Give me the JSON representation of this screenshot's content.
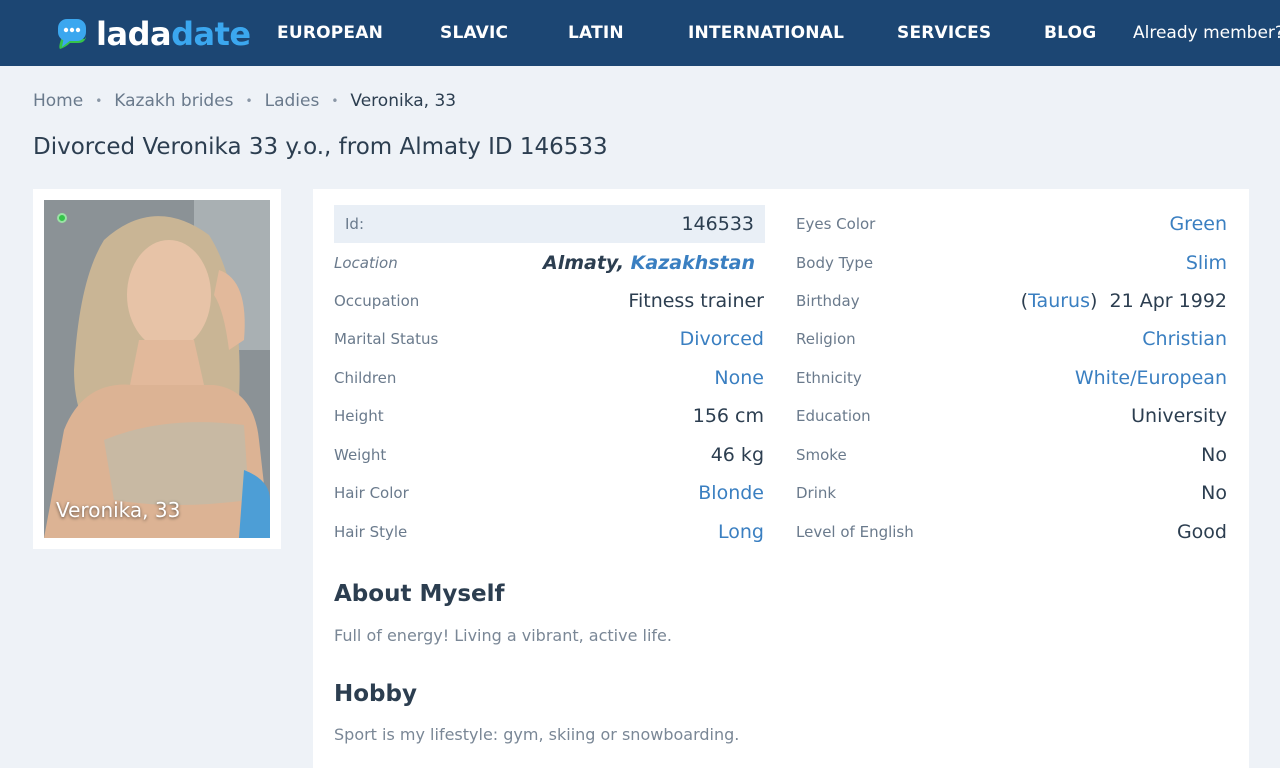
{
  "header": {
    "logo_part1": "lada",
    "logo_part2": "date",
    "nav": [
      "EUROPEAN",
      "SLAVIC",
      "LATIN",
      "INTERNATIONAL",
      "SERVICES",
      "BLOG"
    ],
    "member_link": "Already member?",
    "colors": {
      "bar": "#1c4673",
      "logo_accent": "#3ba7ef"
    }
  },
  "breadcrumb": [
    "Home",
    "Kazakh brides",
    "Ladies",
    "Veronika, 33"
  ],
  "page_title": "Divorced Veronika 33 y.o., from Almaty ID 146533",
  "photo": {
    "caption": "Veronika, 33",
    "status": "online"
  },
  "profile": {
    "id_label": "Id:",
    "id_value": "146533",
    "location_label": "Location",
    "location_city": "Almaty,",
    "location_country": "Kazakhstan",
    "left": [
      {
        "label": "Occupation",
        "value": "Fitness trainer",
        "link": false
      },
      {
        "label": "Marital Status",
        "value": "Divorced",
        "link": true
      },
      {
        "label": "Children",
        "value": "None",
        "link": true
      },
      {
        "label": "Height",
        "value": "156 cm",
        "link": false
      },
      {
        "label": "Weight",
        "value": "46 kg",
        "link": false
      },
      {
        "label": "Hair Color",
        "value": "Blonde",
        "link": true
      },
      {
        "label": "Hair Style",
        "value": "Long",
        "link": true
      }
    ],
    "right": [
      {
        "label": "Eyes Color",
        "value": "Green",
        "link": true
      },
      {
        "label": "Body Type",
        "value": "Slim",
        "link": true
      },
      {
        "label": "Birthday",
        "zodiac": "Taurus",
        "value": "21 Apr 1992"
      },
      {
        "label": "Religion",
        "value": "Christian",
        "link": true
      },
      {
        "label": "Ethnicity",
        "value": "White/European",
        "link": true
      },
      {
        "label": "Education",
        "value": "University",
        "link": false
      },
      {
        "label": "Smoke",
        "value": "No",
        "link": false
      },
      {
        "label": "Drink",
        "value": "No",
        "link": false
      },
      {
        "label": "Level of English",
        "value": "Good",
        "link": false
      }
    ]
  },
  "about": {
    "title": "About Myself",
    "text": "Full of energy! Living a vibrant, active life."
  },
  "hobby": {
    "title": "Hobby",
    "text": "Sport is my lifestyle: gym, skiing or snowboarding."
  }
}
